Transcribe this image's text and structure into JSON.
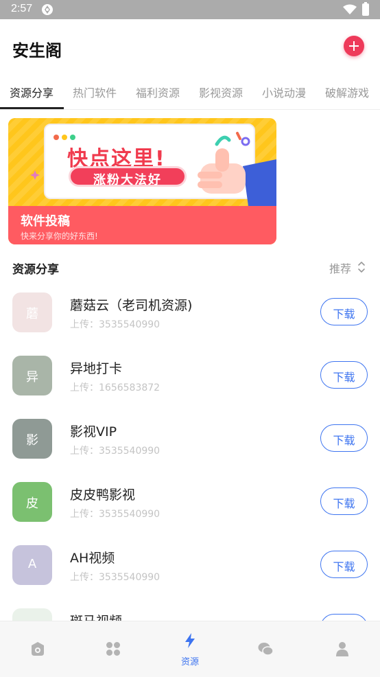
{
  "status_bar": {
    "time": "2:57"
  },
  "header": {
    "title": "安生阁",
    "add_icon": "plus-icon",
    "accent": "#ee3a5a"
  },
  "tabs": [
    {
      "label": "资源分享",
      "active": true
    },
    {
      "label": "热门软件",
      "active": false
    },
    {
      "label": "福利资源",
      "active": false
    },
    {
      "label": "影视资源",
      "active": false
    },
    {
      "label": "小说动漫",
      "active": false
    },
    {
      "label": "破解游戏",
      "active": false
    }
  ],
  "banner": {
    "headline": "快点这里!",
    "pill": "涨粉大法好",
    "footer_title": "软件投稿",
    "footer_subtitle": "快来分享你的好东西!"
  },
  "section": {
    "title": "资源分享",
    "sort_label": "推荐",
    "sort_icon": "sort-updown-icon"
  },
  "list_items": [
    {
      "icon_char": "蘑",
      "icon_color": "#f2e3e3",
      "name": "蘑菇云（老司机资源)",
      "uploader": "上传：3535540990",
      "button": "下载"
    },
    {
      "icon_char": "异",
      "icon_color": "#a9b5a8",
      "name": "异地打卡",
      "uploader": "上传：1656583872",
      "button": "下载"
    },
    {
      "icon_char": "影",
      "icon_color": "#8f9a95",
      "name": "影视VIP",
      "uploader": "上传：3535540990",
      "button": "下载"
    },
    {
      "icon_char": "皮",
      "icon_color": "#7bc070",
      "name": "皮皮鸭影视",
      "uploader": "上传：3535540990",
      "button": "下载"
    },
    {
      "icon_char": "A",
      "icon_color": "#c6c3dc",
      "name": "AH视频",
      "uploader": "上传：3535540990",
      "button": "下载"
    },
    {
      "icon_char": "",
      "icon_color": "#eaf2ea",
      "name": "斑马视频",
      "uploader": "",
      "button": ""
    }
  ],
  "bottom_nav": [
    {
      "icon": "home-icon",
      "label": "",
      "active": false
    },
    {
      "icon": "grid-apps-icon",
      "label": "",
      "active": false
    },
    {
      "icon": "lightning-icon",
      "label": "资源",
      "active": true
    },
    {
      "icon": "chat-bubbles-icon",
      "label": "",
      "active": false
    },
    {
      "icon": "user-icon",
      "label": "",
      "active": false
    }
  ],
  "colors": {
    "primary": "#3d74f0",
    "banner_yellow": "#ffc61c",
    "banner_red": "#ff5b61"
  }
}
